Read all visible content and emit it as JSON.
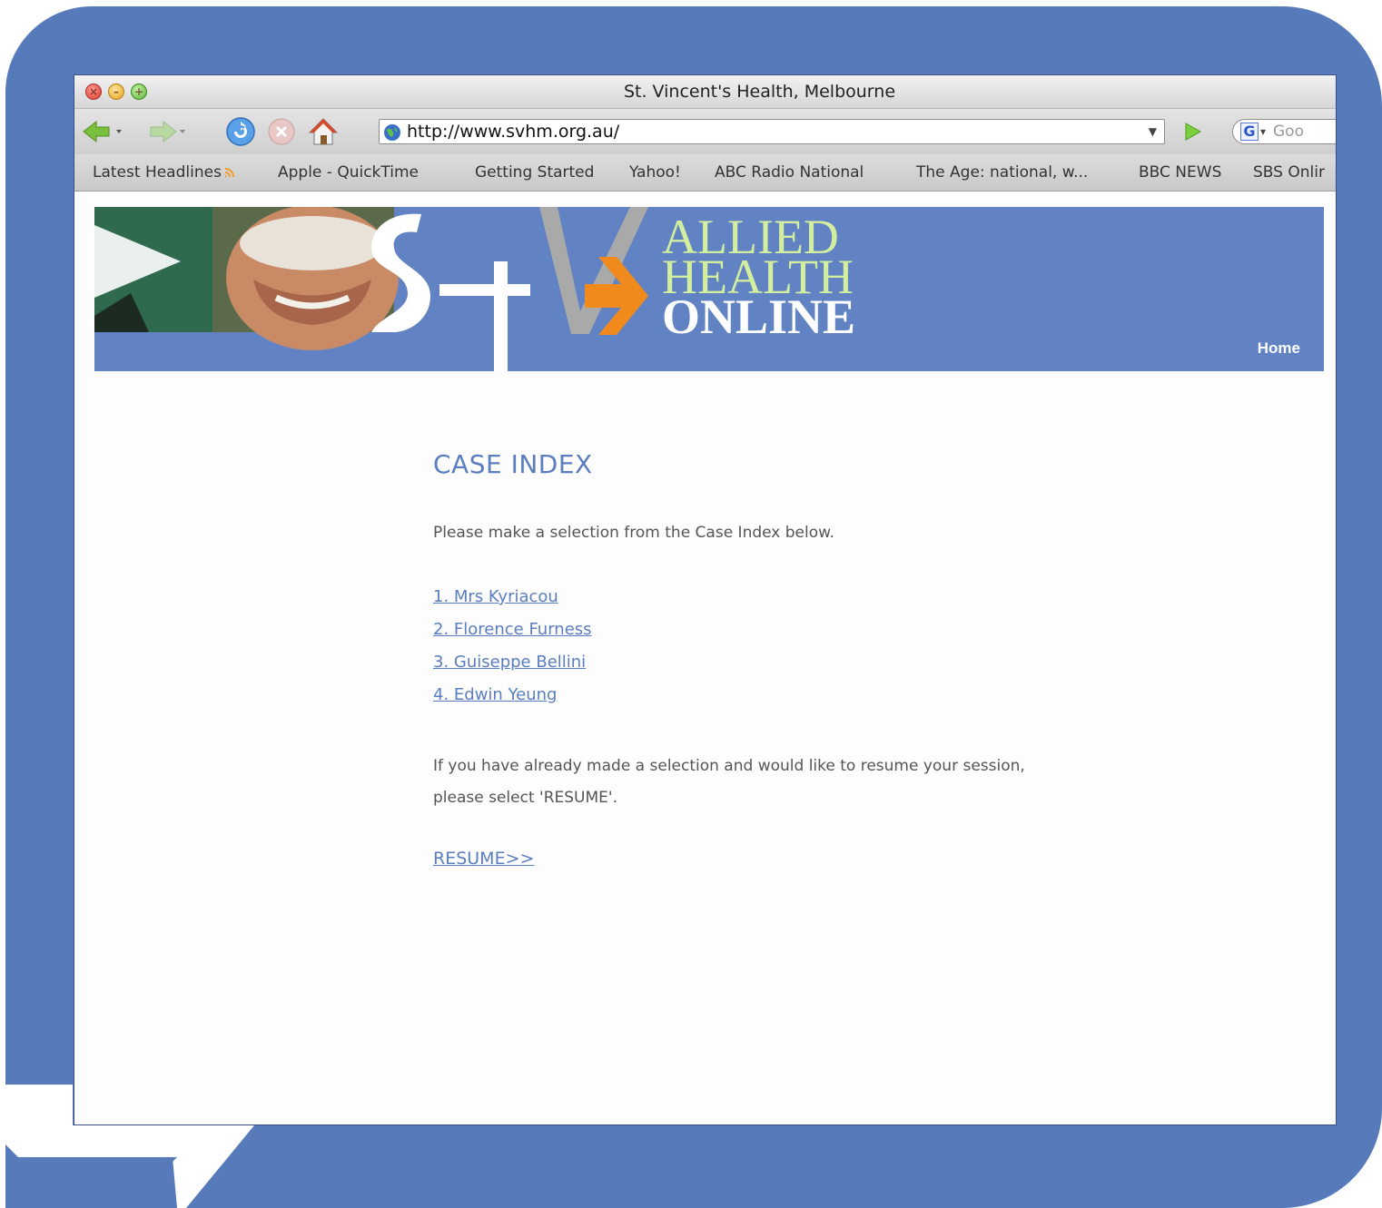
{
  "window": {
    "title": "St. Vincent's Health, Melbourne",
    "traffic_lights": [
      "close",
      "minimize",
      "zoom"
    ]
  },
  "toolbar": {
    "url": "http://www.svhm.org.au/",
    "search_placeholder": "Goo",
    "icons": [
      "back-icon",
      "forward-icon",
      "reload-icon",
      "stop-icon",
      "home-icon",
      "globe-icon",
      "go-icon",
      "google-search-icon"
    ]
  },
  "bookmarks": [
    {
      "label": "Latest Headlines",
      "rss": true
    },
    {
      "label": "Apple - QuickTime"
    },
    {
      "label": "Getting Started"
    },
    {
      "label": "Yahoo!"
    },
    {
      "label": "ABC Radio National"
    },
    {
      "label": "The Age: national, w..."
    },
    {
      "label": "BBC NEWS"
    },
    {
      "label": "SBS Onlir"
    }
  ],
  "banner": {
    "logo_text": "StV",
    "brand_line1": "ALLIED",
    "brand_line2": "HEALTH",
    "brand_line3": "ONLINE",
    "home_label": "Home",
    "colors": {
      "banner": "#6183c4",
      "accent_green": "#d2ee9e",
      "accent_orange": "#f08a1c"
    }
  },
  "content": {
    "title": "CASE INDEX",
    "intro": "Please make a selection from the Case Index below.",
    "cases": [
      {
        "label": "1. Mrs Kyriacou"
      },
      {
        "label": "2. Florence Furness"
      },
      {
        "label": "3. Guiseppe Bellini"
      },
      {
        "label": "4. Edwin Yeung"
      }
    ],
    "resume_note_line1": "If you have already made a selection and would like to resume your session,",
    "resume_note_line2": "please select 'RESUME'.",
    "resume_label": "RESUME>>"
  },
  "colors": {
    "frame": "#577bba",
    "link": "#5b7ec0"
  }
}
